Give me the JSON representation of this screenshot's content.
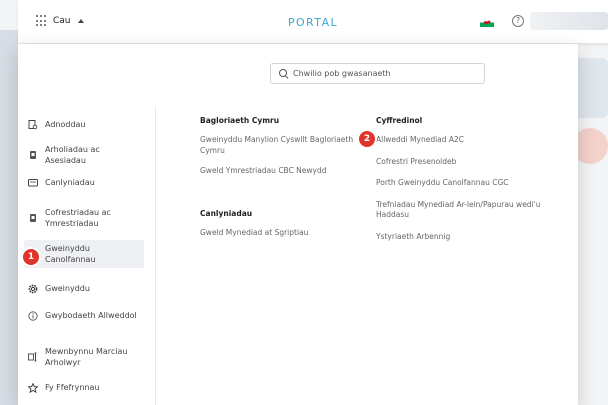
{
  "header": {
    "menu_label": "Cau",
    "portal_title": "PORTAL"
  },
  "search": {
    "placeholder": "Chwilio pob gwasanaeth"
  },
  "sidebar": {
    "items": [
      {
        "label": "Adnoddau",
        "icon": "document-search-icon"
      },
      {
        "label": "Arholiadau ac Asesiadau",
        "icon": "exam-icon"
      },
      {
        "label": "Canlyniadau",
        "icon": "results-icon"
      },
      {
        "label": "Cofrestriadau ac Ymrestriadau",
        "icon": "registration-icon"
      },
      {
        "label": "Gweinyddu Canolfannau",
        "icon": "building-icon"
      },
      {
        "label": "Gweinyddu",
        "icon": "gear-icon"
      },
      {
        "label": "Gwybodaeth Allweddol",
        "icon": "info-icon"
      },
      {
        "label": "Mewnbynnu Marciau Arholwyr",
        "icon": "marks-entry-icon"
      },
      {
        "label": "Fy Ffefrynnau",
        "icon": "star-icon"
      }
    ]
  },
  "columns": {
    "bac": {
      "title": "Bagloriaeth Cymru",
      "links": [
        "Gweinyddu Manylion Cyswllt Bagloriaeth Cymru",
        "Gweld Ymrestriadau CBC Newydd"
      ]
    },
    "results": {
      "title": "Canlyniadau",
      "links": [
        "Gweld Mynediad at Sgriptiau"
      ]
    },
    "general": {
      "title": "Cyffredinol",
      "links": [
        "Allweddi Mynediad A2C",
        "Cofrestri Presenoldeb",
        "Porth Gweinyddu Canolfannau CGC",
        "Trefniadau Mynediad Ar-lein/Papurau wedi'u Haddasu",
        "Ystyriaeth Arbennig"
      ]
    }
  },
  "badges": {
    "one": "1",
    "two": "2"
  },
  "colors": {
    "accent": "#38a8c8",
    "badge": "#e0352b",
    "flag_red": "#c8102e",
    "flag_green": "#00a651"
  }
}
